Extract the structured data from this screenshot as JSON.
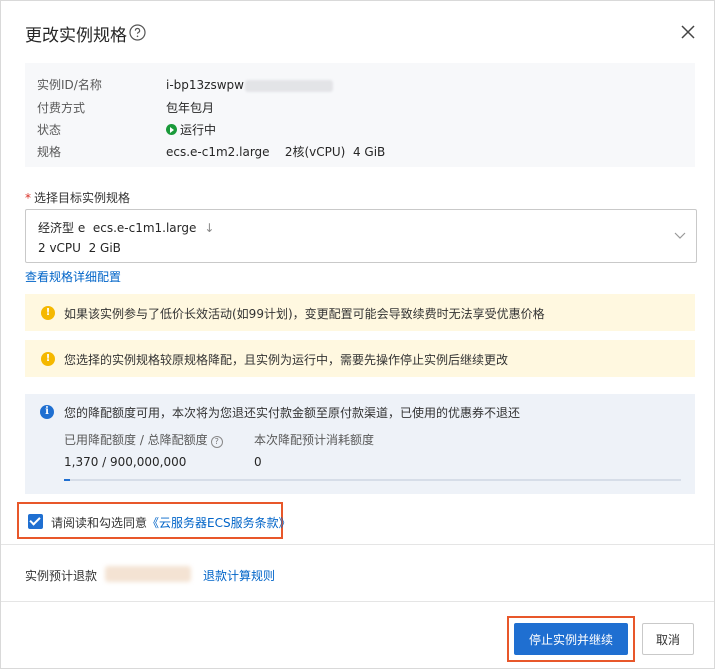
{
  "dialog": {
    "title": "更改实例规格",
    "help_icon": "question-circle-icon",
    "close_icon": "close-icon"
  },
  "instance_info": {
    "id_label": "实例ID/名称",
    "id_value": "i-bp13zswpw",
    "billing_label": "付费方式",
    "billing_value": "包年包月",
    "status_label": "状态",
    "status_value": "运行中",
    "spec_label": "规格",
    "spec_value": "ecs.e-c1m2.large",
    "spec_cpu": "2核(vCPU)",
    "spec_mem": "4 GiB"
  },
  "target_spec": {
    "label": "选择目标实例规格",
    "required_mark": "*",
    "family": "经济型 e",
    "type": "ecs.e-c1m1.large",
    "direction": "↓",
    "cpu": "2 vCPU",
    "mem": "2 GiB"
  },
  "detail_link": "查看规格详细配置",
  "warnings": [
    "如果该实例参与了低价长效活动(如99计划)，变更配置可能会导致续费时无法享受优惠价格",
    "您选择的实例规格较原规格降配，且实例为运行中，需要先操作停止实例后继续更改"
  ],
  "notice": {
    "text": "您的降配额度可用，本次将为您退还实付款金额至原付款渠道，已使用的优惠券不退还",
    "quota_label": "已用降配额度 / 总降配额度",
    "quota_value": "1,370 / 900,000,000",
    "consume_label": "本次降配预计消耗额度",
    "consume_value": "0",
    "progress_fraction": 0.01
  },
  "agreement": {
    "checked": true,
    "text": "请阅读和勾选同意",
    "link": "《云服务器ECS服务条款》"
  },
  "refund": {
    "label": "实例预计退款",
    "rules_link": "退款计算规则"
  },
  "buttons": {
    "primary": "停止实例并继续",
    "cancel": "取消"
  },
  "colors": {
    "primary": "#1f6fd1",
    "link": "#0064c8",
    "warning_bg": "#fff8e0",
    "highlight_border": "#e8572a",
    "running": "#1a9a3a"
  }
}
